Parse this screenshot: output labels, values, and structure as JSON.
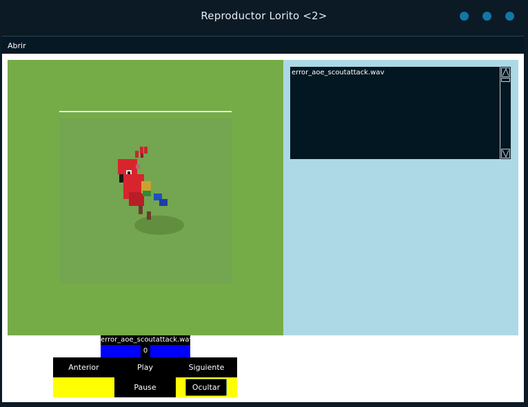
{
  "window": {
    "title": "Reproductor Lorito <2>"
  },
  "menu": {
    "open_label": "Abrir"
  },
  "playlist": {
    "items": [
      "error_aoe_scoutattack.wav"
    ]
  },
  "now_playing": {
    "filename": "error_aoe_scoutattack.wav",
    "counter": "0"
  },
  "controls": {
    "previous_label": "Anterior",
    "play_label": "Play",
    "next_label": "Siguiente",
    "pause_label": "Pause",
    "hide_label": "Ocultar"
  },
  "colors": {
    "video_bg": "#75ac47",
    "panel_bg": "#add8e6",
    "playlist_bg": "#031722",
    "accent_yellow": "#ffff00",
    "accent_blue": "#0000ff",
    "window_button": "#1376a6"
  },
  "icons": [
    "minimize-icon",
    "maximize-icon",
    "close-icon",
    "parrot-image"
  ]
}
